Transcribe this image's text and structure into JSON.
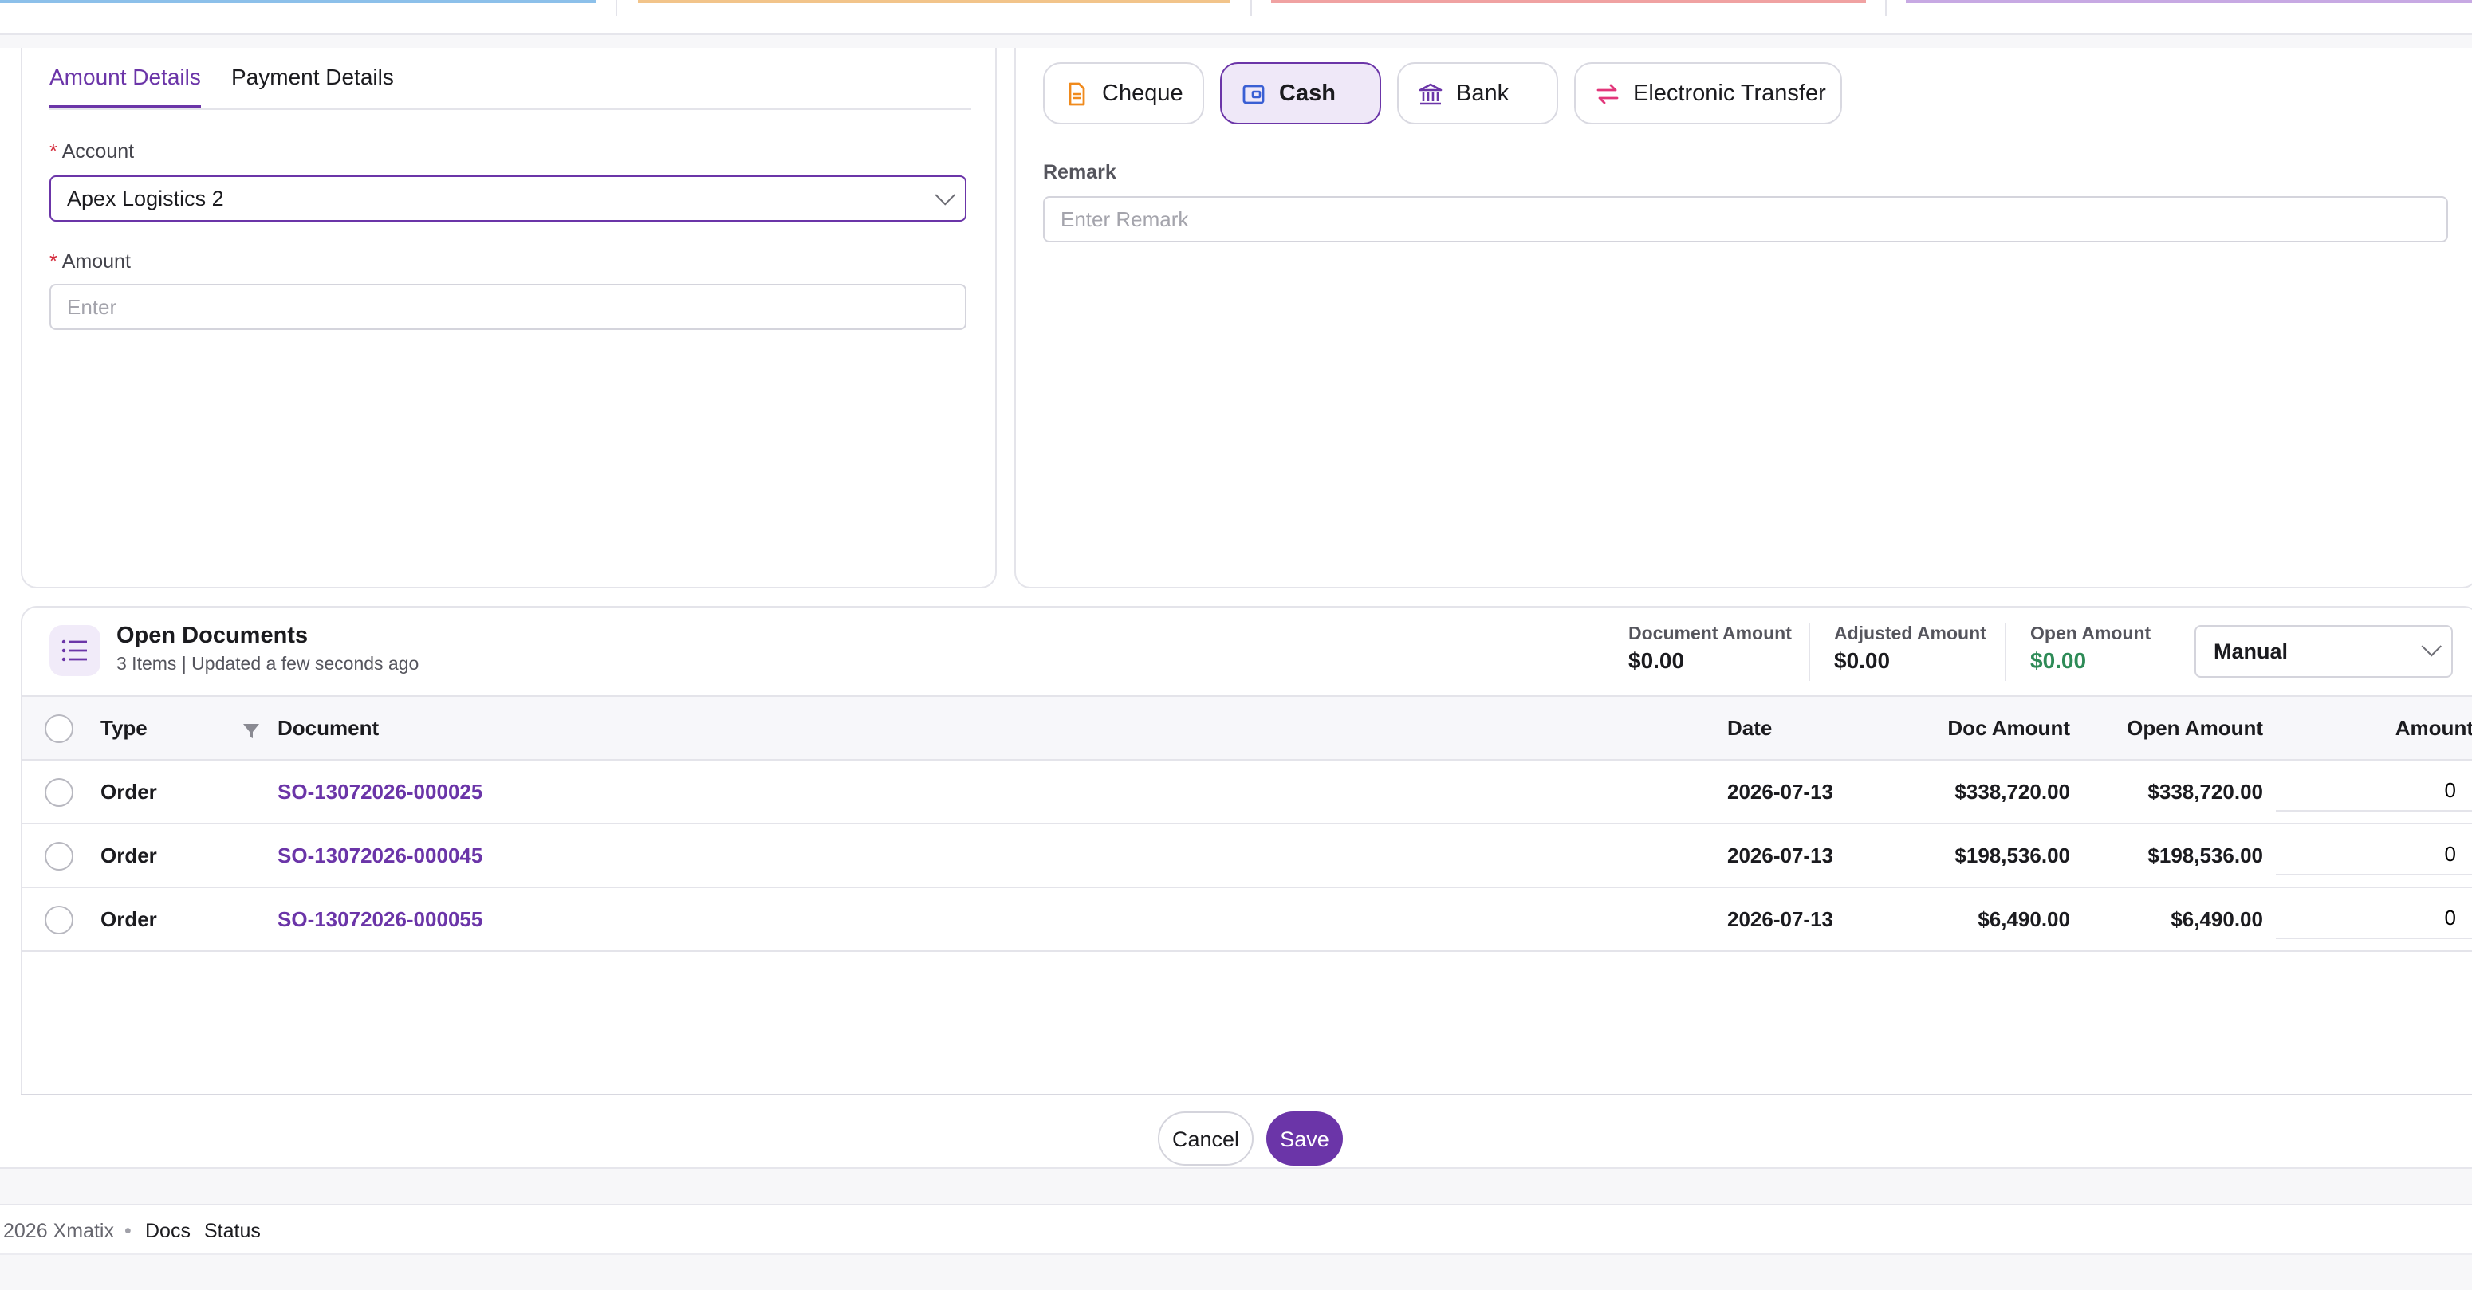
{
  "colors": {
    "accent": "#6b35a8",
    "positive": "#2e8b57",
    "required": "#d3293a"
  },
  "tabs": [
    {
      "label": "Amount Details",
      "active": true
    },
    {
      "label": "Payment Details",
      "active": false
    }
  ],
  "form": {
    "account_label": "Account",
    "account_value": "Apex Logistics 2",
    "amount_label": "Amount",
    "amount_placeholder": "Enter",
    "required_mark": "*"
  },
  "payment_methods": [
    {
      "label": "Cheque",
      "icon": "document-icon",
      "active": false
    },
    {
      "label": "Cash",
      "icon": "wallet-icon",
      "active": true
    },
    {
      "label": "Bank",
      "icon": "bank-icon",
      "active": false
    },
    {
      "label": "Electronic Transfer",
      "icon": "transfer-arrows-icon",
      "active": false
    }
  ],
  "remark": {
    "label": "Remark",
    "placeholder": "Enter Remark"
  },
  "open_documents": {
    "title": "Open Documents",
    "subtitle": "3 Items | Updated a few seconds ago",
    "summary": [
      {
        "label": "Document Amount",
        "value": "$0.00"
      },
      {
        "label": "Adjusted Amount",
        "value": "$0.00"
      },
      {
        "label": "Open Amount",
        "value": "$0.00"
      }
    ],
    "mode": "Manual",
    "columns": [
      "Type",
      "Document",
      "Date",
      "Doc Amount",
      "Open Amount",
      "Amount"
    ],
    "rows": [
      {
        "type": "Order",
        "document": "SO-13072026-000025",
        "date": "2026-07-13",
        "doc_amount": "$338,720.00",
        "open_amount": "$338,720.00",
        "amount": "0"
      },
      {
        "type": "Order",
        "document": "SO-13072026-000045",
        "date": "2026-07-13",
        "doc_amount": "$198,536.00",
        "open_amount": "$198,536.00",
        "amount": "0"
      },
      {
        "type": "Order",
        "document": "SO-13072026-000055",
        "date": "2026-07-13",
        "doc_amount": "$6,490.00",
        "open_amount": "$6,490.00",
        "amount": "0"
      }
    ]
  },
  "actions": {
    "cancel": "Cancel",
    "save": "Save"
  },
  "footer": {
    "copyright": "2026 Xmatix",
    "separator": "•",
    "docs": "Docs",
    "status": "Status"
  }
}
